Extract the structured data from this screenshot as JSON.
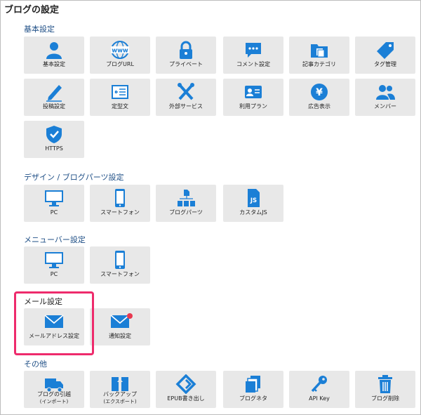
{
  "page_title": "ブログの設定",
  "colors": {
    "icon": "#1b7fd6",
    "tile_bg": "#e8e8e8",
    "section_title": "#1f4f86",
    "highlight": "#ee2b6c",
    "badge": "#e8384f"
  },
  "sections": {
    "basic": {
      "title": "基本設定",
      "items": [
        "基本設定",
        "ブログURL",
        "プライベート",
        "コメント設定",
        "記事カテゴリ",
        "タグ管理",
        "投稿設定",
        "定型文",
        "外部サービス",
        "利用プラン",
        "広告表示",
        "メンバー",
        "HTTPS"
      ],
      "www_text": "www",
      "yen_text": "¥"
    },
    "design": {
      "title": "デザイン / ブログパーツ設定",
      "items": [
        "PC",
        "スマートフォン",
        "ブログパーツ",
        "カスタムJS"
      ],
      "js_text": "JS"
    },
    "menubar": {
      "title": "メニューバー設定",
      "items": [
        "PC",
        "スマートフォン"
      ]
    },
    "mail": {
      "title": "メール設定",
      "items": [
        "メールアドレス設定",
        "通知設定"
      ]
    },
    "other": {
      "title": "その他",
      "items": [
        {
          "line1": "ブログの引越",
          "line2": "(インポート)"
        },
        {
          "line1": "バックアップ",
          "line2": "(エクスポート)"
        },
        "EPUB書き出し",
        "ブログネタ",
        "API Key",
        "ブログ削除"
      ]
    }
  }
}
